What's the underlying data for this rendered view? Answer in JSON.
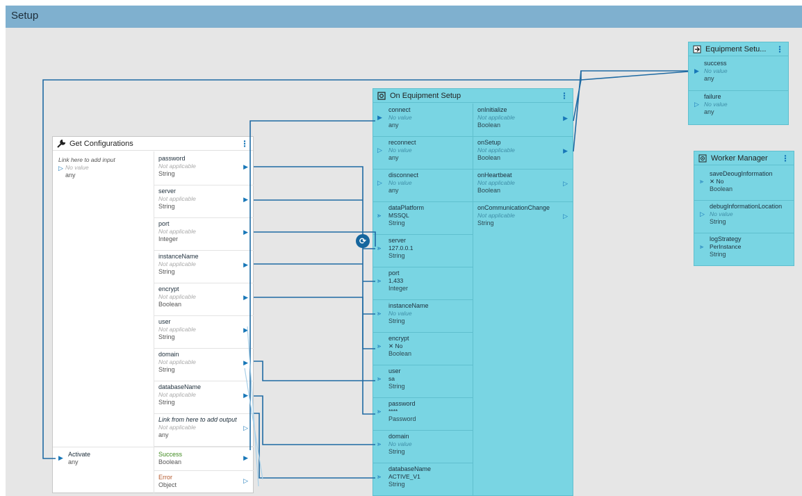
{
  "window": {
    "title": "Setup"
  },
  "get_configurations": {
    "title": "Get Configurations",
    "input_hint": "Link here to add input",
    "input_value": "No value",
    "input_type": "any",
    "outputs": [
      {
        "name": "password",
        "value": "Not applicable",
        "type": "String"
      },
      {
        "name": "server",
        "value": "Not applicable",
        "type": "String"
      },
      {
        "name": "port",
        "value": "Not applicable",
        "type": "Integer"
      },
      {
        "name": "instanceName",
        "value": "Not applicable",
        "type": "String"
      },
      {
        "name": "encrypt",
        "value": "Not applicable",
        "type": "Boolean"
      },
      {
        "name": "user",
        "value": "Not applicable",
        "type": "String"
      },
      {
        "name": "domain",
        "value": "Not applicable",
        "type": "String"
      },
      {
        "name": "databaseName",
        "value": "Not applicable",
        "type": "String"
      },
      {
        "name": "Link from here to add output",
        "value": "Not applicable",
        "type": "any"
      }
    ],
    "activate": {
      "name": "Activate",
      "type": "any"
    },
    "success": {
      "name": "Success",
      "type": "Boolean"
    },
    "error": {
      "name": "Error",
      "type": "Object"
    }
  },
  "on_equipment_setup": {
    "title": "On Equipment Setup",
    "inputs": [
      {
        "name": "connect",
        "value": "No value",
        "type": "any"
      },
      {
        "name": "reconnect",
        "value": "No value",
        "type": "any"
      },
      {
        "name": "disconnect",
        "value": "No value",
        "type": "any"
      },
      {
        "name": "dataPlatform",
        "value": "MSSQL",
        "type": "String"
      },
      {
        "name": "server",
        "value": "127.0.0.1",
        "type": "String"
      },
      {
        "name": "port",
        "value": "1,433",
        "type": "Integer"
      },
      {
        "name": "instanceName",
        "value": "No value",
        "type": "String"
      },
      {
        "name": "encrypt",
        "value": "✕ No",
        "type": "Boolean"
      },
      {
        "name": "user",
        "value": "sa",
        "type": "String"
      },
      {
        "name": "password",
        "value": "****",
        "type": "Password"
      },
      {
        "name": "domain",
        "value": "No value",
        "type": "String"
      },
      {
        "name": "databaseName",
        "value": "ACTIVE_V1",
        "type": "String"
      }
    ],
    "outputs": [
      {
        "name": "onInitialize",
        "value": "Not applicable",
        "type": "Boolean"
      },
      {
        "name": "onSetup",
        "value": "Not applicable",
        "type": "Boolean"
      },
      {
        "name": "onHeartbeat",
        "value": "Not applicable",
        "type": "Boolean"
      },
      {
        "name": "onCommunicationChange",
        "value": "Not applicable",
        "type": "String"
      }
    ]
  },
  "equipment_setup": {
    "title": "Equipment Setu...",
    "inputs": [
      {
        "name": "success",
        "value": "No value",
        "type": "any"
      },
      {
        "name": "failure",
        "value": "No value",
        "type": "any"
      }
    ]
  },
  "worker_manager": {
    "title": "Worker Manager",
    "inputs": [
      {
        "name": "saveDeougInformation",
        "value": "✕ No",
        "type": "Boolean"
      },
      {
        "name": "debugInformationLocation",
        "value": "No value",
        "type": "String"
      },
      {
        "name": "logStrategy",
        "value": "PerInstance",
        "type": "String"
      }
    ]
  },
  "colors": {
    "accent": "#1877b8",
    "node_cyan": "#79d5e3",
    "title_bar": "#7fb0cf",
    "canvas": "#e6e6e6",
    "success": "#3e8a1e",
    "error": "#b45a2e"
  }
}
